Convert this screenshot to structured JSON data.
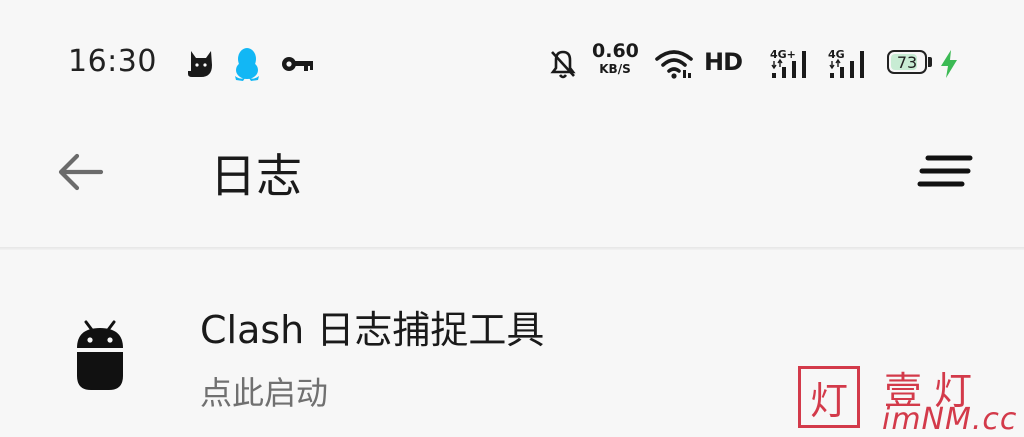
{
  "status_bar": {
    "time": "16:30",
    "notification_icons": [
      "cat-icon",
      "qq-penguin-icon",
      "key-icon"
    ],
    "mute_icon": "bell-off-icon",
    "net_speed_value": "0.60",
    "net_speed_unit": "KB/S",
    "wifi_icon": "wifi-icon",
    "hd_label": "HD",
    "signal_1_label": "4G+",
    "signal_2_label": "4G",
    "battery_level": "73",
    "charging_icon": "bolt-icon"
  },
  "toolbar": {
    "back_icon": "arrow-left-icon",
    "title": "日志",
    "menu_icon": "sort-icon"
  },
  "list": {
    "items": [
      {
        "icon": "android-icon",
        "title": "Clash 日志捕捉工具",
        "subtitle": "点此启动"
      }
    ]
  },
  "watermark": {
    "box_char": "灯",
    "name": "壹灯",
    "url": "imNM.cc"
  },
  "colors": {
    "background": "#f7f7f7",
    "text_primary": "#1a1a1a",
    "text_secondary": "#707070",
    "charging": "#3cba54",
    "qq": "#12b7f5",
    "watermark": "#d33a4a"
  }
}
